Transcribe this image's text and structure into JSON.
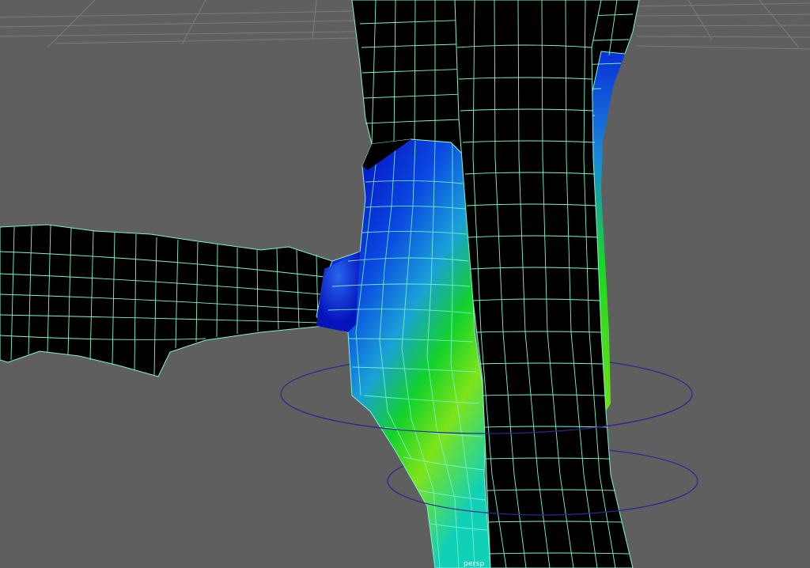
{
  "viewport": {
    "camera_label": "persp"
  },
  "colors": {
    "background": "#5f5f5f",
    "grid": "#7c7c7c",
    "mesh_fill": "#000000",
    "wireframe": "#7ff5cf",
    "selection_circle": "#2a2a8c",
    "weight_high": "#22e016",
    "weight_mid": "#1ea8d8",
    "weight_low": "#0a1fd2",
    "weight_peak": "#7be818"
  }
}
